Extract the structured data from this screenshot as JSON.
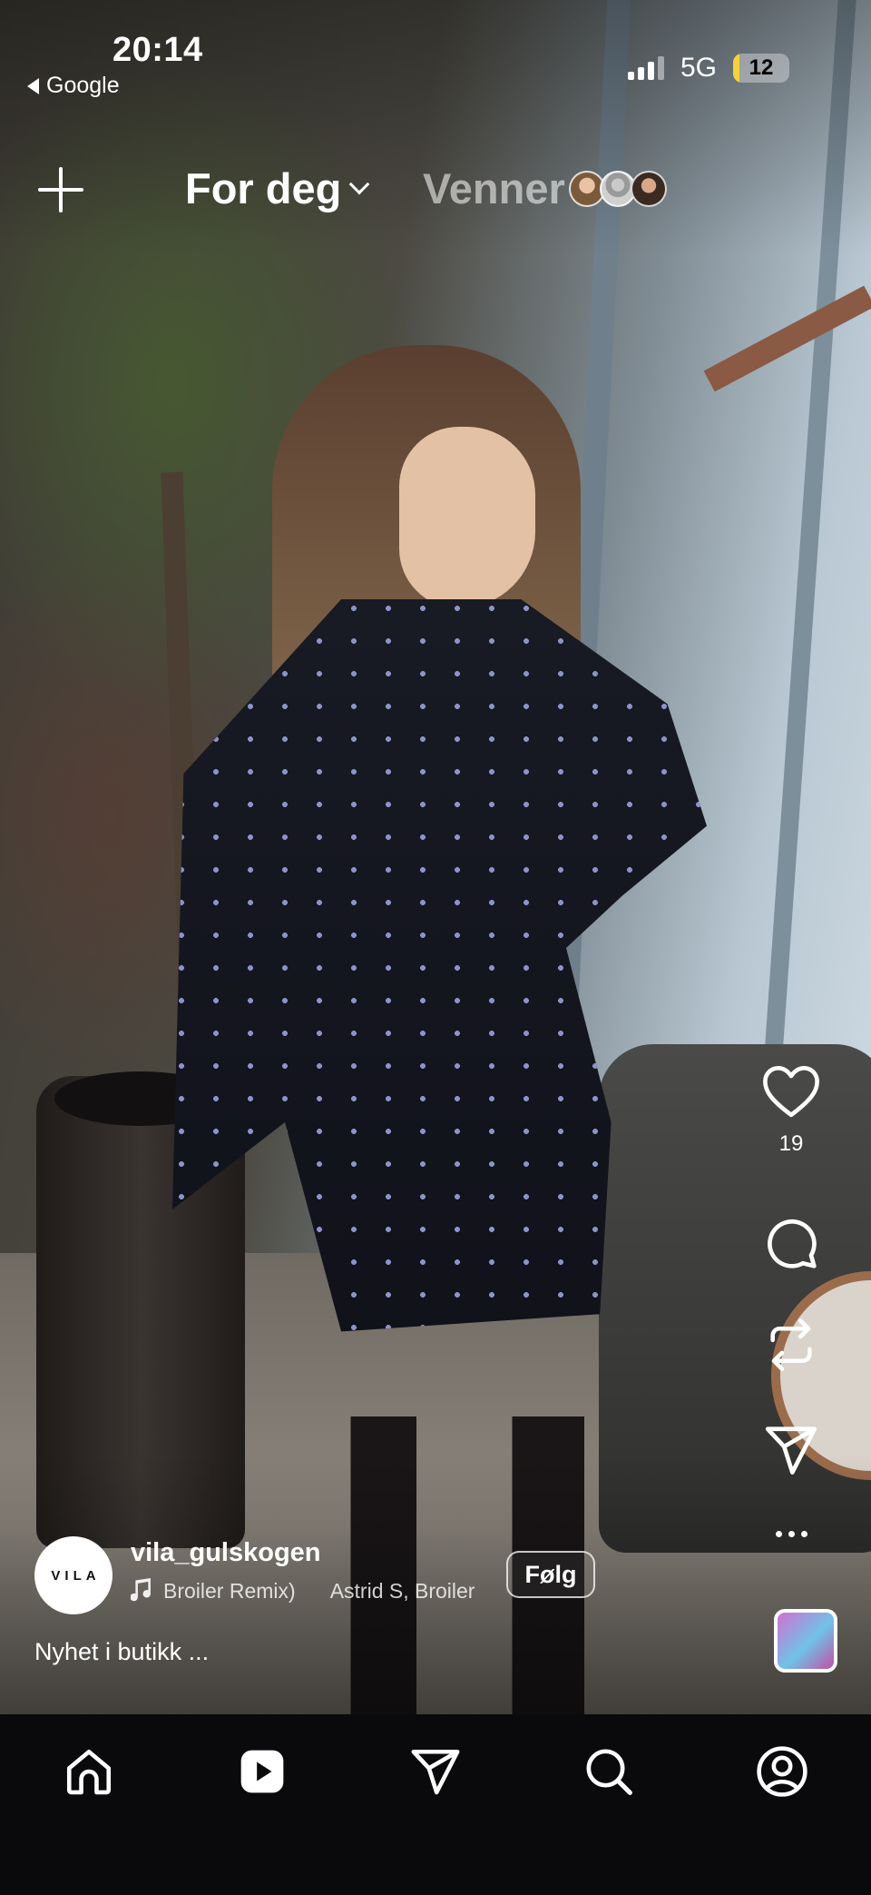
{
  "status_bar": {
    "time": "20:14",
    "back_app": "Google",
    "network": "5G",
    "battery_level": "12",
    "battery_fraction": 0.12,
    "battery_color": "#f6d23a"
  },
  "top_nav": {
    "create_icon": "plus-icon",
    "tab_for_you": "For deg",
    "tab_friends": "Venner"
  },
  "post": {
    "author_logo_text": "VILA",
    "username": "vila_gulskogen",
    "song_title": "Broiler Remix)",
    "artist": "Astrid S, Broiler",
    "follow_label": "Følg",
    "caption": "Nyhet i butikk ..."
  },
  "actions": {
    "like_count": "19",
    "icons": [
      "heart-icon",
      "comment-icon",
      "repost-icon",
      "send-icon",
      "more-icon"
    ]
  },
  "bottom_nav": {
    "items": [
      "home-icon",
      "reels-icon",
      "messages-icon",
      "search-icon",
      "profile-icon"
    ]
  }
}
